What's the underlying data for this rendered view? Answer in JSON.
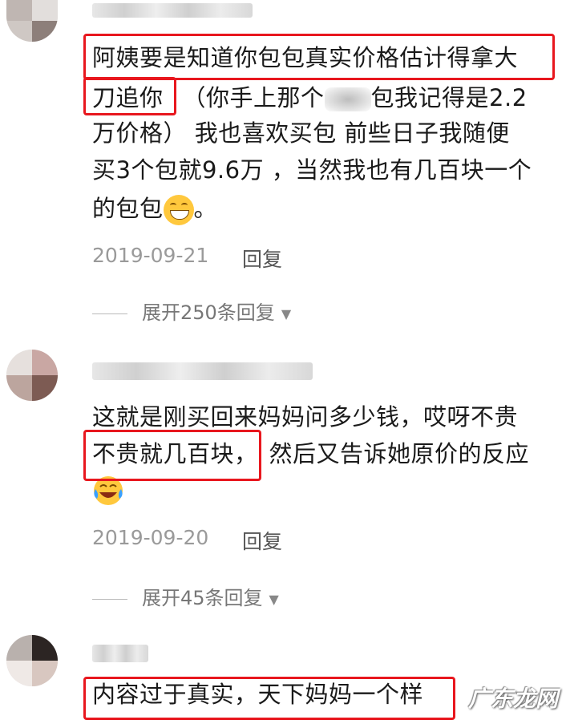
{
  "comments": [
    {
      "lines": [
        "阿姨要是知道你包包真实价格估计得拿大",
        "刀追你",
        "（你手上那个",
        "包我记得是2.2",
        "万价格）  我也喜欢买包  前些日子我随便",
        "买3个包就9.6万 ，当然我也有几百块一个",
        "的包包",
        "。"
      ],
      "date": "2019-09-21",
      "reply_label": "回复",
      "expand_label": "展开250条回复"
    },
    {
      "lines": [
        "这就是刚买回来妈妈问多少钱，哎呀不贵",
        "不贵就几百块，",
        "然后又告诉她原价的反应"
      ],
      "date": "2019-09-20",
      "reply_label": "回复",
      "expand_label": "展开45条回复"
    },
    {
      "lines": [
        "内容过于真实，天下妈妈一个样"
      ]
    }
  ],
  "watermark": "广东龙网",
  "colors": {
    "highlight": "#e8171e",
    "meta": "#9a9a9a"
  }
}
